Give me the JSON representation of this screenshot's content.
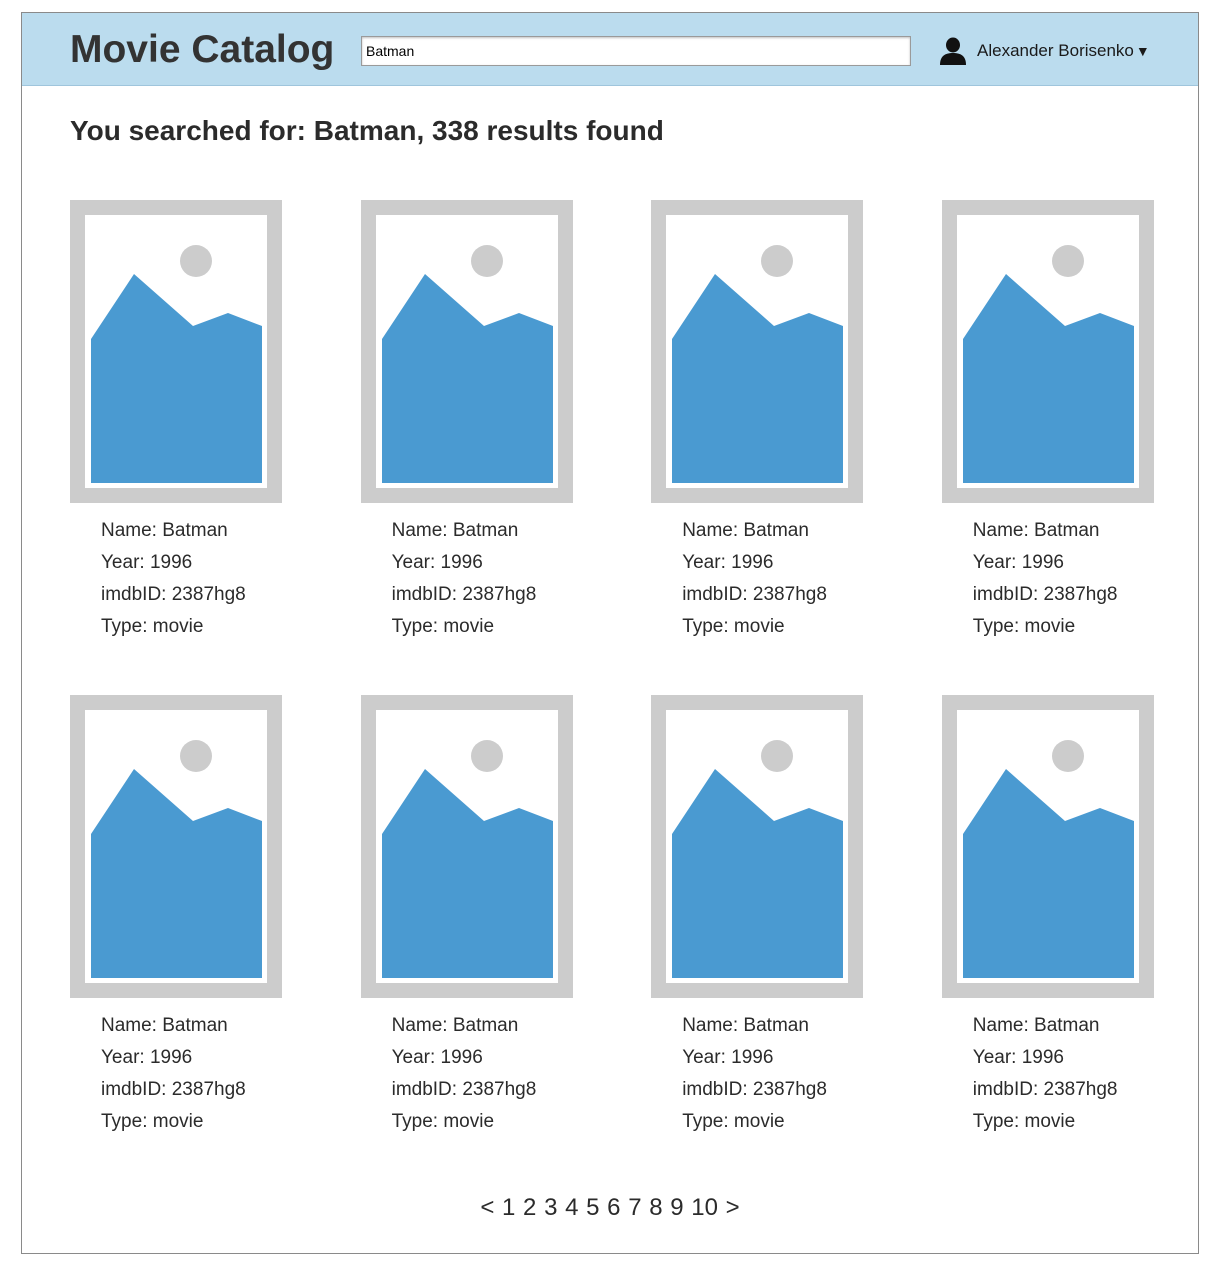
{
  "header": {
    "title": "Movie Catalog",
    "search_value": "Batman",
    "user_name": "Alexander Borisenko",
    "caret": "▼",
    "colors": {
      "background": "#bbdcee"
    }
  },
  "results": {
    "heading": "You searched for: Batman, 338 results found"
  },
  "movies": [
    {
      "name": "Name: Batman",
      "year": "Year: 1996",
      "imdb": "imdbID: 2387hg8",
      "type": "Type: movie"
    },
    {
      "name": "Name: Batman",
      "year": "Year: 1996",
      "imdb": "imdbID: 2387hg8",
      "type": "Type: movie"
    },
    {
      "name": "Name: Batman",
      "year": "Year: 1996",
      "imdb": "imdbID: 2387hg8",
      "type": "Type: movie"
    },
    {
      "name": "Name: Batman",
      "year": "Year: 1996",
      "imdb": "imdbID: 2387hg8",
      "type": "Type: movie"
    },
    {
      "name": "Name: Batman",
      "year": "Year: 1996",
      "imdb": "imdbID: 2387hg8",
      "type": "Type: movie"
    },
    {
      "name": "Name: Batman",
      "year": "Year: 1996",
      "imdb": "imdbID: 2387hg8",
      "type": "Type: movie"
    },
    {
      "name": "Name: Batman",
      "year": "Year: 1996",
      "imdb": "imdbID: 2387hg8",
      "type": "Type: movie"
    },
    {
      "name": "Name: Batman",
      "year": "Year: 1996",
      "imdb": "imdbID: 2387hg8",
      "type": "Type: movie"
    }
  ],
  "placeholder_image": {
    "icon": "image-placeholder-icon",
    "frame_color": "#cccccc",
    "mountain_color": "#4a9ad1",
    "sun_color": "#cccccc"
  },
  "pagination": {
    "prev": "<",
    "pages": [
      "1",
      "2",
      "3",
      "4",
      "5",
      "6",
      "7",
      "8",
      "9",
      "10"
    ],
    "next": ">"
  }
}
